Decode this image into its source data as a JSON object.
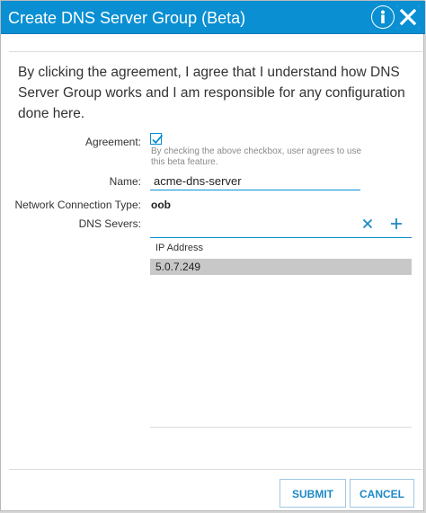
{
  "dialog": {
    "title": "Create DNS Server Group (Beta)",
    "info_icon": "info-icon",
    "close_icon": "close-icon",
    "accent_color": "#0a8fd3"
  },
  "intro": "By clicking the agreement, I agree that I understand how DNS Server Group works and I am responsible for any configuration done here.",
  "form": {
    "agreement_label": "Agreement:",
    "agreement_checked": true,
    "agreement_help": "By checking the above checkbox, user agrees to use this beta feature.",
    "name_label": "Name:",
    "name_value": "acme-dns-server",
    "network_label": "Network Connection Type:",
    "network_value": "oob",
    "dns_label": "DNS Severs:",
    "delete_icon": "close-icon",
    "add_icon": "plus-icon"
  },
  "table": {
    "columns": [
      "IP Address"
    ],
    "rows": [
      {
        "ip": "5.0.7.249",
        "selected": true
      }
    ]
  },
  "footer": {
    "submit_label": "SUBMIT",
    "cancel_label": "CANCEL"
  }
}
